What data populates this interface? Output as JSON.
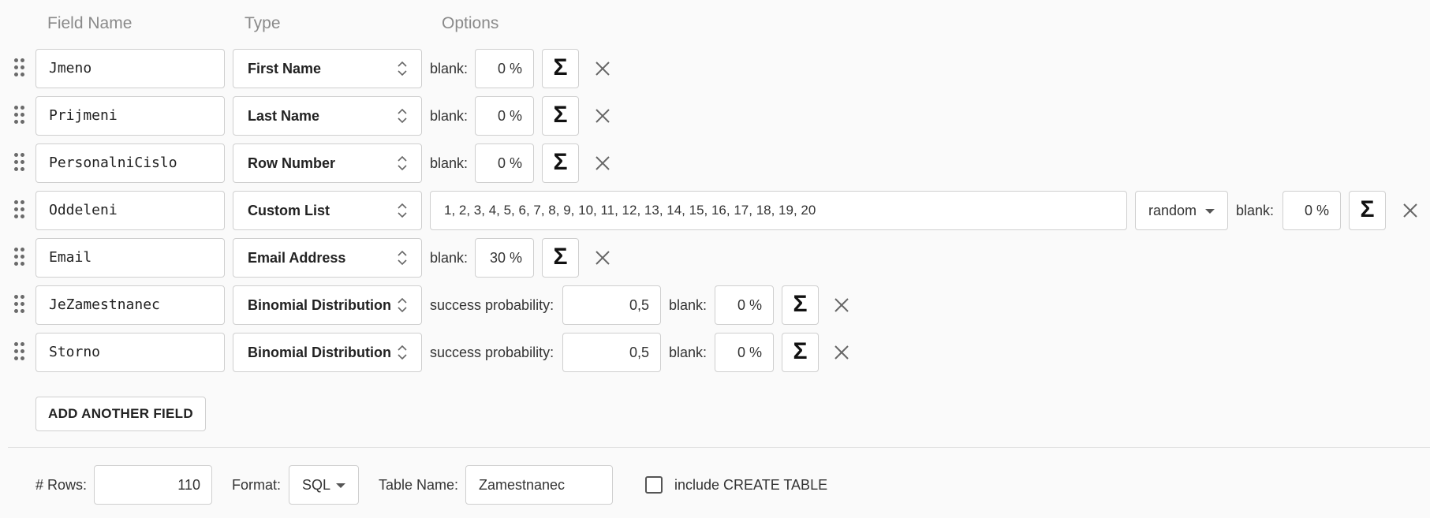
{
  "headers": {
    "field_name": "Field Name",
    "type": "Type",
    "options": "Options"
  },
  "labels": {
    "blank": "blank:",
    "success_probability": "success probability:"
  },
  "icons": {
    "drag": "drag-handle-icon",
    "sigma": "sigma-icon",
    "close": "close-icon",
    "select": "chevron-updown-icon",
    "dropdown": "caret-down-icon"
  },
  "sigma_glyph": "Σ",
  "rows": [
    {
      "name": "Jmeno",
      "type": "First Name",
      "blank": "0 %"
    },
    {
      "name": "Prijmeni",
      "type": "Last Name",
      "blank": "0 %"
    },
    {
      "name": "PersonalniCislo",
      "type": "Row Number",
      "blank": "0 %"
    },
    {
      "name": "Oddeleni",
      "type": "Custom List",
      "values": "1, 2, 3, 4, 5, 6, 7, 8, 9, 10, 11, 12, 13, 14, 15, 16, 17, 18, 19, 20",
      "order": "random",
      "blank": "0 %"
    },
    {
      "name": "Email",
      "type": "Email Address",
      "blank": "30 %"
    },
    {
      "name": "JeZamestnanec",
      "type": "Binomial Distribution",
      "probability": "0,5",
      "blank": "0 %"
    },
    {
      "name": "Storno",
      "type": "Binomial Distribution",
      "probability": "0,5",
      "blank": "0 %"
    }
  ],
  "add_field_label": "ADD ANOTHER FIELD",
  "footer": {
    "rows_label": "# Rows:",
    "rows_value": "110",
    "format_label": "Format:",
    "format_value": "SQL",
    "table_name_label": "Table Name:",
    "table_name_value": "Zamestnanec",
    "create_table_label": "include CREATE TABLE",
    "create_table_checked": false
  }
}
